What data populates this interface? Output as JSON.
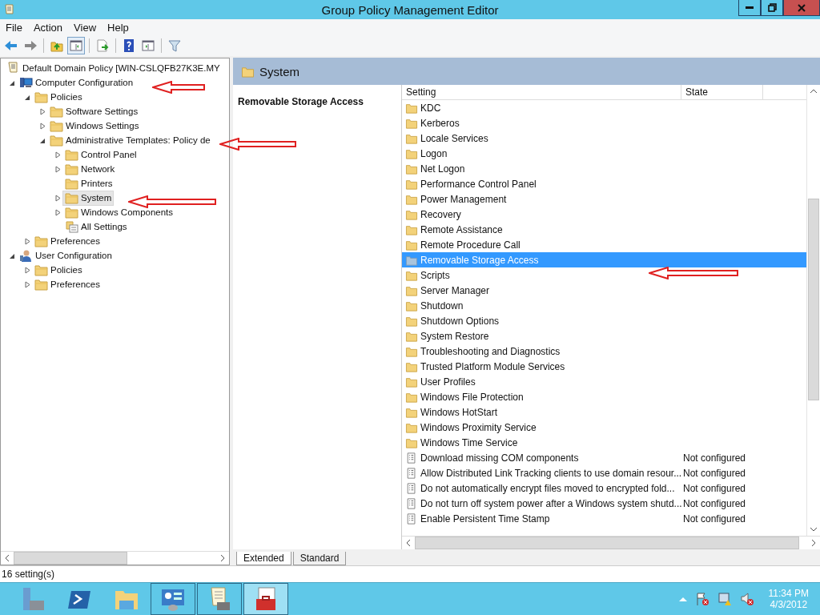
{
  "window": {
    "title": "Group Policy Management Editor"
  },
  "menu": [
    "File",
    "Action",
    "View",
    "Help"
  ],
  "toolbar": [
    {
      "kind": "back",
      "pressed": false
    },
    {
      "kind": "forward",
      "pressed": false
    },
    {
      "kind": "up",
      "pressed": false
    },
    {
      "kind": "tree",
      "pressed": true
    },
    {
      "kind": "export",
      "pressed": false
    },
    {
      "kind": "help",
      "pressed": false
    },
    {
      "kind": "pane",
      "pressed": false
    },
    {
      "kind": "filter",
      "pressed": false
    }
  ],
  "tree": [
    {
      "label": "Default Domain Policy [WIN-CSLQFB27K3E.MY",
      "kind": "policy",
      "selected": false,
      "children": [
        {
          "label": "Computer Configuration",
          "kind": "computer",
          "expanded": true,
          "selected": false,
          "children": [
            {
              "label": "Policies",
              "kind": "folder",
              "expanded": true,
              "selected": false,
              "children": [
                {
                  "label": "Software Settings",
                  "kind": "folder",
                  "expanded": false,
                  "selected": false
                },
                {
                  "label": "Windows Settings",
                  "kind": "folder",
                  "expanded": false,
                  "selected": false
                },
                {
                  "label": "Administrative Templates: Policy de",
                  "kind": "folder",
                  "expanded": true,
                  "selected": false,
                  "children": [
                    {
                      "label": "Control Panel",
                      "kind": "folder",
                      "expanded": false,
                      "selected": false
                    },
                    {
                      "label": "Network",
                      "kind": "folder",
                      "expanded": false,
                      "selected": false
                    },
                    {
                      "label": "Printers",
                      "kind": "folder",
                      "selected": false
                    },
                    {
                      "label": "System",
                      "kind": "folder",
                      "expanded": false,
                      "selected": true
                    },
                    {
                      "label": "Windows Components",
                      "kind": "folder",
                      "expanded": false,
                      "selected": false
                    },
                    {
                      "label": "All Settings",
                      "kind": "settings",
                      "selected": false
                    }
                  ]
                }
              ]
            },
            {
              "label": "Preferences",
              "kind": "folder",
              "expanded": false,
              "selected": false
            }
          ]
        },
        {
          "label": "User Configuration",
          "kind": "user",
          "expanded": true,
          "selected": false,
          "children": [
            {
              "label": "Policies",
              "kind": "folder",
              "expanded": false,
              "selected": false
            },
            {
              "label": "Preferences",
              "kind": "folder",
              "expanded": false,
              "selected": false
            }
          ]
        }
      ]
    }
  ],
  "details": {
    "header": "System",
    "description_title": "Removable Storage Access",
    "columns": [
      "Setting",
      "State"
    ],
    "rows": [
      {
        "kind": "folder",
        "name": "KDC",
        "selected": false
      },
      {
        "kind": "folder",
        "name": "Kerberos",
        "selected": false
      },
      {
        "kind": "folder",
        "name": "Locale Services",
        "selected": false
      },
      {
        "kind": "folder",
        "name": "Logon",
        "selected": false
      },
      {
        "kind": "folder",
        "name": "Net Logon",
        "selected": false
      },
      {
        "kind": "folder",
        "name": "Performance Control Panel",
        "selected": false
      },
      {
        "kind": "folder",
        "name": "Power Management",
        "selected": false
      },
      {
        "kind": "folder",
        "name": "Recovery",
        "selected": false
      },
      {
        "kind": "folder",
        "name": "Remote Assistance",
        "selected": false
      },
      {
        "kind": "folder",
        "name": "Remote Procedure Call",
        "selected": false
      },
      {
        "kind": "folder",
        "name": "Removable Storage Access",
        "selected": true
      },
      {
        "kind": "folder",
        "name": "Scripts",
        "selected": false
      },
      {
        "kind": "folder",
        "name": "Server Manager",
        "selected": false
      },
      {
        "kind": "folder",
        "name": "Shutdown",
        "selected": false
      },
      {
        "kind": "folder",
        "name": "Shutdown Options",
        "selected": false
      },
      {
        "kind": "folder",
        "name": "System Restore",
        "selected": false
      },
      {
        "kind": "folder",
        "name": "Troubleshooting and Diagnostics",
        "selected": false
      },
      {
        "kind": "folder",
        "name": "Trusted Platform Module Services",
        "selected": false
      },
      {
        "kind": "folder",
        "name": "User Profiles",
        "selected": false
      },
      {
        "kind": "folder",
        "name": "Windows File Protection",
        "selected": false
      },
      {
        "kind": "folder",
        "name": "Windows HotStart",
        "selected": false
      },
      {
        "kind": "folder",
        "name": "Windows Proximity Service",
        "selected": false
      },
      {
        "kind": "folder",
        "name": "Windows Time Service",
        "selected": false
      },
      {
        "kind": "setting",
        "name": "Download missing COM components",
        "state": "Not configured",
        "selected": false
      },
      {
        "kind": "setting",
        "name": "Allow Distributed Link Tracking clients to use domain resour...",
        "state": "Not configured",
        "selected": false
      },
      {
        "kind": "setting",
        "name": "Do not automatically encrypt files moved to encrypted fold...",
        "state": "Not configured",
        "selected": false
      },
      {
        "kind": "setting",
        "name": "Do not turn off system power after a Windows system shutd...",
        "state": "Not configured",
        "selected": false
      },
      {
        "kind": "setting",
        "name": "Enable Persistent Time Stamp",
        "state": "Not configured",
        "selected": false
      }
    ]
  },
  "tabs": [
    {
      "label": "Extended",
      "selected": true
    },
    {
      "label": "Standard",
      "selected": false
    }
  ],
  "status_bar": "16 setting(s)",
  "taskbar": [
    {
      "kind": "server",
      "running": false,
      "selected": false
    },
    {
      "kind": "shell",
      "running": false,
      "selected": false
    },
    {
      "kind": "explorer",
      "running": false,
      "selected": false
    },
    {
      "kind": "control",
      "running": true,
      "selected": false
    },
    {
      "kind": "policy",
      "running": true,
      "selected": false
    },
    {
      "kind": "toolbox",
      "running": true,
      "selected": true
    }
  ],
  "clock": {
    "time": "11:34 PM",
    "date": "4/3/2012"
  }
}
